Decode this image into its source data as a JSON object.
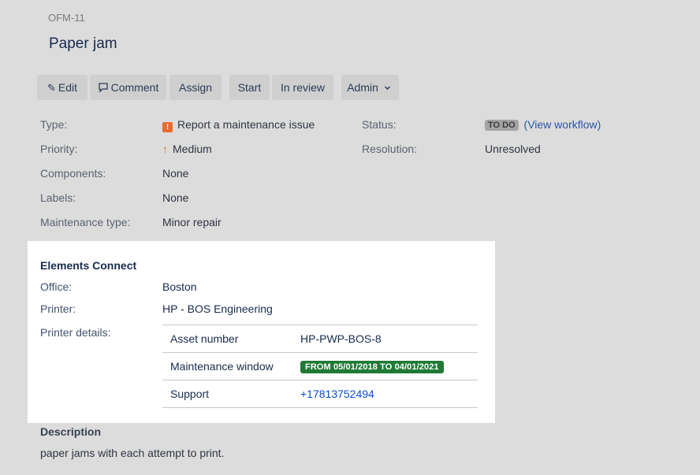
{
  "issue": {
    "key": "OFM-11",
    "title": "Paper jam"
  },
  "toolbar": {
    "edit_label": "Edit",
    "comment_label": "Comment",
    "assign_label": "Assign",
    "start_label": "Start",
    "in_review_label": "In review",
    "admin_label": "Admin",
    "edit_icon": "pencil-icon",
    "comment_icon": "comment-icon",
    "admin_icon": "chevron-down-icon"
  },
  "fields": {
    "type_label": "Type:",
    "type_value": "Report a maintenance issue",
    "type_icon": "alert-icon",
    "priority_label": "Priority:",
    "priority_value": "Medium",
    "priority_icon": "arrow-up-icon",
    "components_label": "Components:",
    "components_value": "None",
    "labels_label": "Labels:",
    "labels_value": "None",
    "maintenance_type_label": "Maintenance type:",
    "maintenance_type_value": "Minor repair",
    "status_label": "Status:",
    "status_value": "TO DO",
    "view_workflow_open": "(",
    "view_workflow_link": "View workflow",
    "view_workflow_close": ")",
    "resolution_label": "Resolution:",
    "resolution_value": "Unresolved"
  },
  "elements_connect": {
    "title": "Elements Connect",
    "office_label": "Office:",
    "office_value": "Boston",
    "printer_label": "Printer:",
    "printer_value": "HP - BOS Engineering",
    "printer_details_label": "Printer details:",
    "details": {
      "asset_label": "Asset number",
      "asset_value": "HP-PWP-BOS-8",
      "window_label": "Maintenance window",
      "window_value": "FROM 05/01/2018 TO 04/01/2021",
      "support_label": "Support",
      "support_value": "+17813752494"
    }
  },
  "description": {
    "title": "Description",
    "text": "paper jams with each attempt to print."
  },
  "colors": {
    "overlay_background": "#dcdcdc",
    "panel_background": "#ffffff",
    "window_lozenge": "#1f7a35",
    "link": "#0b4fc4",
    "type_icon": "#e76a2e"
  }
}
